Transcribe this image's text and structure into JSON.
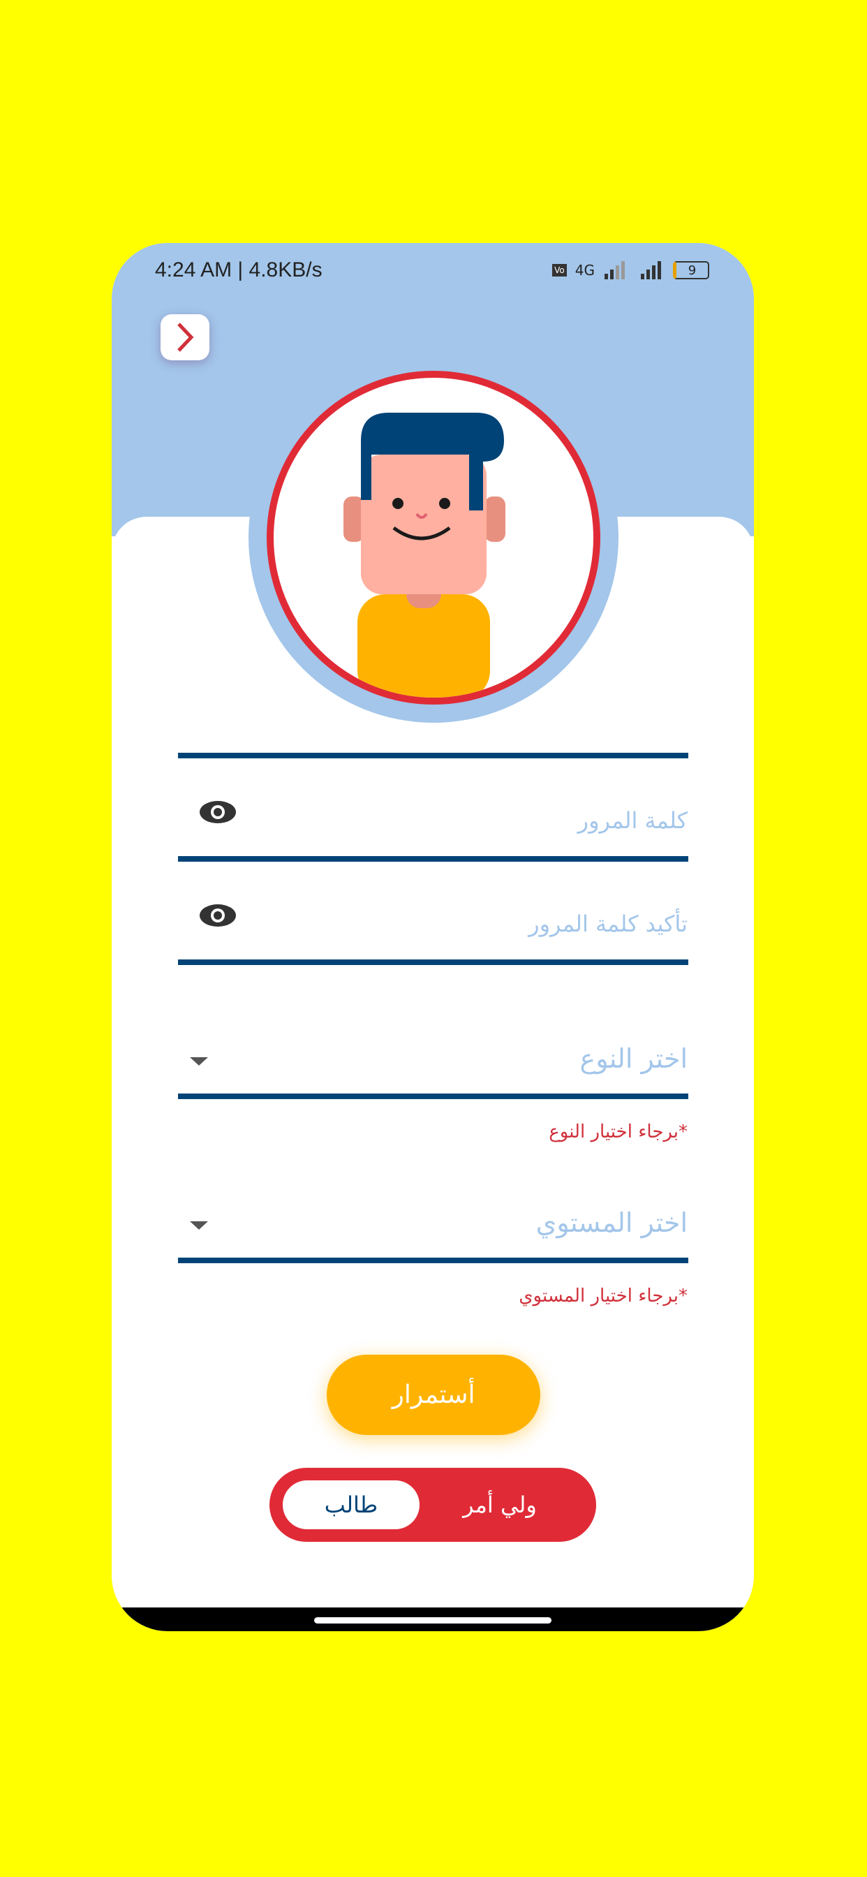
{
  "status_bar": {
    "time_speed": "4:24 AM | 4.8KB/s",
    "network": "4G",
    "battery": "9"
  },
  "form": {
    "password_placeholder": "كلمة المرور",
    "confirm_password_placeholder": "تأكيد كلمة المرور",
    "type_dropdown": "اختر النوع",
    "type_error": "*برجاء اختيار النوع",
    "level_dropdown": "اختر المستوي",
    "level_error": "*برجاء اختيار المستوي"
  },
  "continue_label": "أستمرار",
  "role_toggle": {
    "selected": "طالب",
    "other": "ولي أمر"
  },
  "colors": {
    "background": "#FFFF00",
    "header": "#A3C6EA",
    "accent_red": "#E02B37",
    "button": "#FFB300",
    "line": "#004377"
  }
}
